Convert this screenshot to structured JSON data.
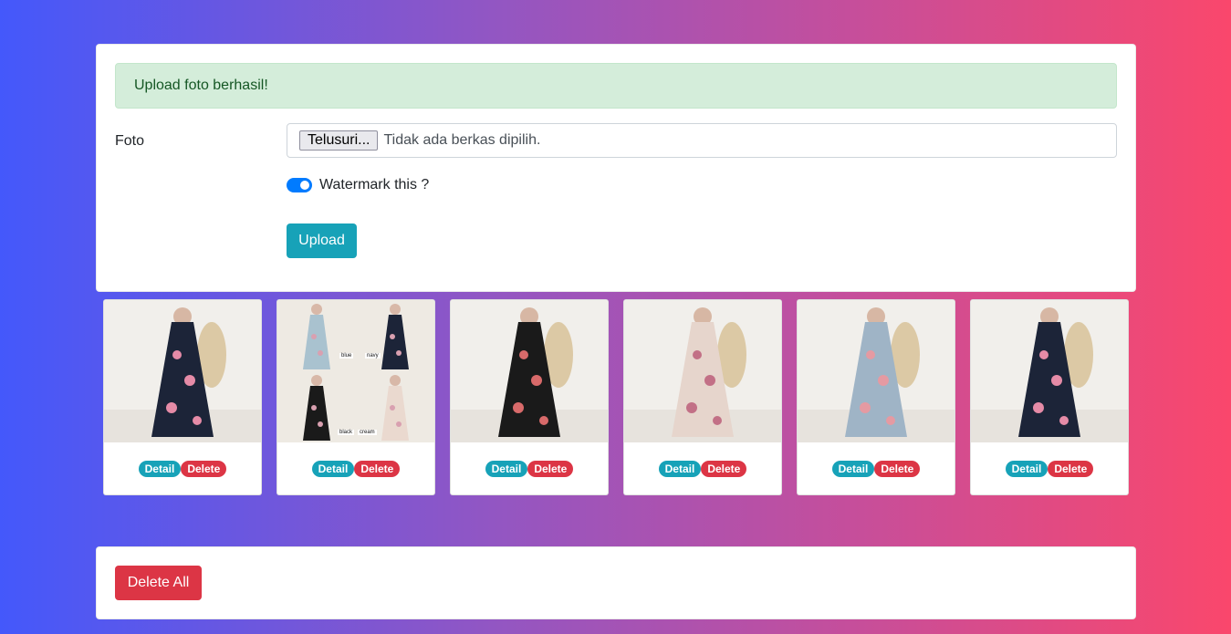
{
  "alert": {
    "text": "Upload foto berhasil!",
    "color": "#d4edda"
  },
  "form": {
    "foto_label": "Foto",
    "file_button_label": "Telusuri...",
    "file_status": "Tidak ada berkas dipilih.",
    "watermark_label": "Watermark this ?",
    "watermark_enabled": true,
    "upload_label": "Upload"
  },
  "photos": [
    {
      "alt": "navy-floral-dress-photo",
      "dress": "#1c2438",
      "flowers": "#e58ba7",
      "captions": []
    },
    {
      "alt": "four-color-collage-photo",
      "dress": "#6c6a5e",
      "flowers": "#d9a0b0",
      "captions": [
        "blue",
        "navy",
        "black",
        "cream"
      ]
    },
    {
      "alt": "black-floral-dress-photo",
      "dress": "#1a1a1a",
      "flowers": "#d86a6a",
      "captions": []
    },
    {
      "alt": "cream-floral-dress-photo",
      "dress": "#e6d5cc",
      "flowers": "#c27086",
      "captions": []
    },
    {
      "alt": "blue-floral-dress-photo",
      "dress": "#9fb4c6",
      "flowers": "#e59aa2",
      "captions": []
    },
    {
      "alt": "navy-floral-dress-photo",
      "dress": "#1c2438",
      "flowers": "#e58ba7",
      "captions": []
    }
  ],
  "photo_actions": {
    "detail_label": "Detail",
    "delete_label": "Delete"
  },
  "bottom": {
    "delete_all_label": "Delete All"
  },
  "colors": {
    "primary": "#007bff",
    "info": "#17a2b8",
    "danger": "#dc3545"
  }
}
